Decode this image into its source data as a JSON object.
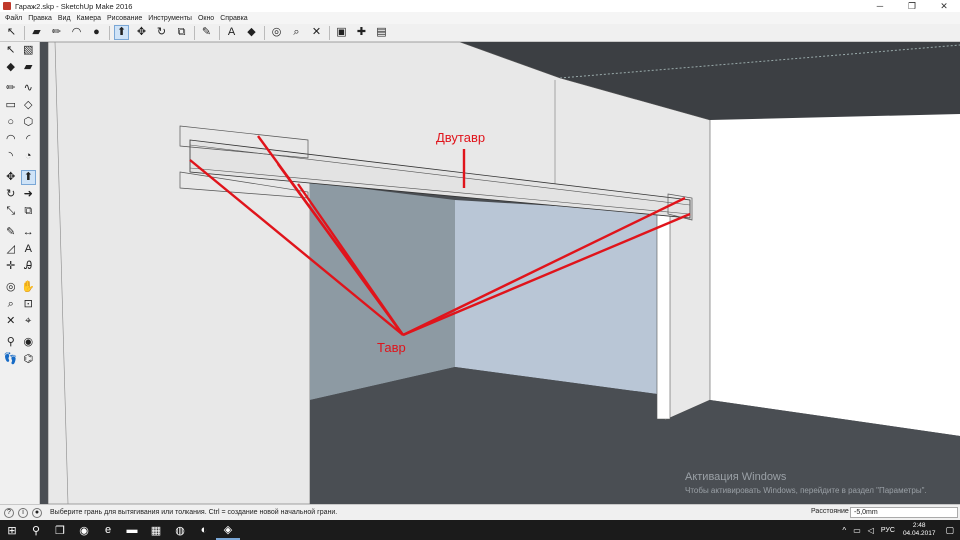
{
  "window": {
    "title": "Гараж2.skp - SketchUp Make 2016",
    "controls": {
      "minimize": "─",
      "maximize": "❐",
      "close": "✕"
    }
  },
  "menu": [
    "Файл",
    "Правка",
    "Вид",
    "Камера",
    "Рисование",
    "Инструменты",
    "Окно",
    "Справка"
  ],
  "toolbar_top": [
    {
      "name": "select-icon",
      "glyph": "↖"
    },
    {
      "name": "eraser-icon",
      "glyph": "▰"
    },
    {
      "name": "pencil-icon",
      "glyph": "✏"
    },
    {
      "name": "arc-icon",
      "glyph": "◠"
    },
    {
      "name": "shapes-icon",
      "glyph": "●"
    },
    {
      "name": "push-pull-icon",
      "glyph": "⬆",
      "active": true
    },
    {
      "name": "move-icon",
      "glyph": "✥"
    },
    {
      "name": "rotate-icon",
      "glyph": "↻"
    },
    {
      "name": "offset-icon",
      "glyph": "⧉"
    },
    {
      "name": "tape-measure-icon",
      "glyph": "✎"
    },
    {
      "name": "text-icon",
      "glyph": "A"
    },
    {
      "name": "paint-bucket-icon",
      "glyph": "◆"
    },
    {
      "name": "orbit-icon",
      "glyph": "◎"
    },
    {
      "name": "zoom-icon",
      "glyph": "⌕"
    },
    {
      "name": "zoom-extents-icon",
      "glyph": "✕"
    },
    {
      "name": "warehouse-icon",
      "glyph": "▣"
    },
    {
      "name": "extension-warehouse-icon",
      "glyph": "✚"
    },
    {
      "name": "layout-icon",
      "glyph": "▤"
    }
  ],
  "toolbar_left": [
    [
      {
        "name": "select-icon",
        "glyph": "↖"
      },
      {
        "name": "make-component-icon",
        "glyph": "▧"
      }
    ],
    [
      {
        "name": "paint-bucket-icon",
        "glyph": "◆"
      },
      {
        "name": "eraser-icon",
        "glyph": "▰"
      }
    ],
    [
      {
        "name": "line-icon",
        "glyph": "✏"
      },
      {
        "name": "freehand-icon",
        "glyph": "∿"
      }
    ],
    [
      {
        "name": "rectangle-icon",
        "glyph": "▭"
      },
      {
        "name": "rotated-rectangle-icon",
        "glyph": "◇"
      }
    ],
    [
      {
        "name": "circle-icon",
        "glyph": "○"
      },
      {
        "name": "polygon-icon",
        "glyph": "⬡"
      }
    ],
    [
      {
        "name": "arc-icon",
        "glyph": "◠"
      },
      {
        "name": "two-point-arc-icon",
        "glyph": "◜"
      }
    ],
    [
      {
        "name": "three-point-arc-icon",
        "glyph": "◝"
      },
      {
        "name": "pie-icon",
        "glyph": "◔"
      }
    ],
    [
      {
        "name": "move-icon",
        "glyph": "✥"
      },
      {
        "name": "push-pull-icon",
        "glyph": "⬆",
        "active": true
      }
    ],
    [
      {
        "name": "rotate-icon",
        "glyph": "↻"
      },
      {
        "name": "follow-me-icon",
        "glyph": "➜"
      }
    ],
    [
      {
        "name": "scale-icon",
        "glyph": "⤡"
      },
      {
        "name": "offset-icon",
        "glyph": "⧉"
      }
    ],
    [
      {
        "name": "tape-measure-icon",
        "glyph": "✎"
      },
      {
        "name": "dimension-icon",
        "glyph": "↔"
      }
    ],
    [
      {
        "name": "protractor-icon",
        "glyph": "◿"
      },
      {
        "name": "text-icon",
        "glyph": "A"
      }
    ],
    [
      {
        "name": "axes-icon",
        "glyph": "✛"
      },
      {
        "name": "3d-text-icon",
        "glyph": "Ꭿ"
      }
    ],
    [
      {
        "name": "orbit-icon",
        "glyph": "◎"
      },
      {
        "name": "pan-icon",
        "glyph": "✋"
      }
    ],
    [
      {
        "name": "zoom-icon",
        "glyph": "⌕"
      },
      {
        "name": "zoom-window-icon",
        "glyph": "⊡"
      }
    ],
    [
      {
        "name": "zoom-extents-icon",
        "glyph": "✕"
      },
      {
        "name": "previous-view-icon",
        "glyph": "⌖"
      }
    ],
    [
      {
        "name": "position-camera-icon",
        "glyph": "⚲"
      },
      {
        "name": "look-around-icon",
        "glyph": "◉"
      }
    ],
    [
      {
        "name": "walk-icon",
        "glyph": "👣"
      },
      {
        "name": "section-plane-icon",
        "glyph": "⌬"
      }
    ]
  ],
  "annotations": {
    "i_beam": "Двутавр",
    "t_beam": "Тавр",
    "color": "#e0141b"
  },
  "watermark": {
    "title": "Активация Windows",
    "subtitle": "Чтобы активировать Windows, перейдите в раздел \"Параметры\"."
  },
  "status": {
    "hint": "Выберите грань для вытягивания или толкания.  Ctrl = создание новой начальной грани.",
    "measurement_label": "Расстояние",
    "measurement_value": "-5,0mm"
  },
  "taskbar": {
    "apps": [
      {
        "name": "start-icon",
        "glyph": "⊞"
      },
      {
        "name": "search-icon",
        "glyph": "⚲"
      },
      {
        "name": "task-view-icon",
        "glyph": "❐"
      },
      {
        "name": "app-icon",
        "glyph": "◉"
      },
      {
        "name": "edge-icon",
        "glyph": "e"
      },
      {
        "name": "explorer-icon",
        "glyph": "▬"
      },
      {
        "name": "store-icon",
        "glyph": "▦"
      },
      {
        "name": "chrome-icon",
        "glyph": "◍"
      },
      {
        "name": "steam-icon",
        "glyph": "◐"
      },
      {
        "name": "sketchup-icon",
        "glyph": "◈",
        "open": true
      }
    ],
    "tray": {
      "language": "РУС",
      "time": "2:48",
      "date": "04.04.2017"
    }
  },
  "colors": {
    "wall": "#e8e8e8",
    "floor": "#4a4e53",
    "ceiling": "#3c3f43",
    "opening_back": "#b9c6d6",
    "opening_side": "#8d9aa3",
    "annotation": "#e0141b"
  }
}
